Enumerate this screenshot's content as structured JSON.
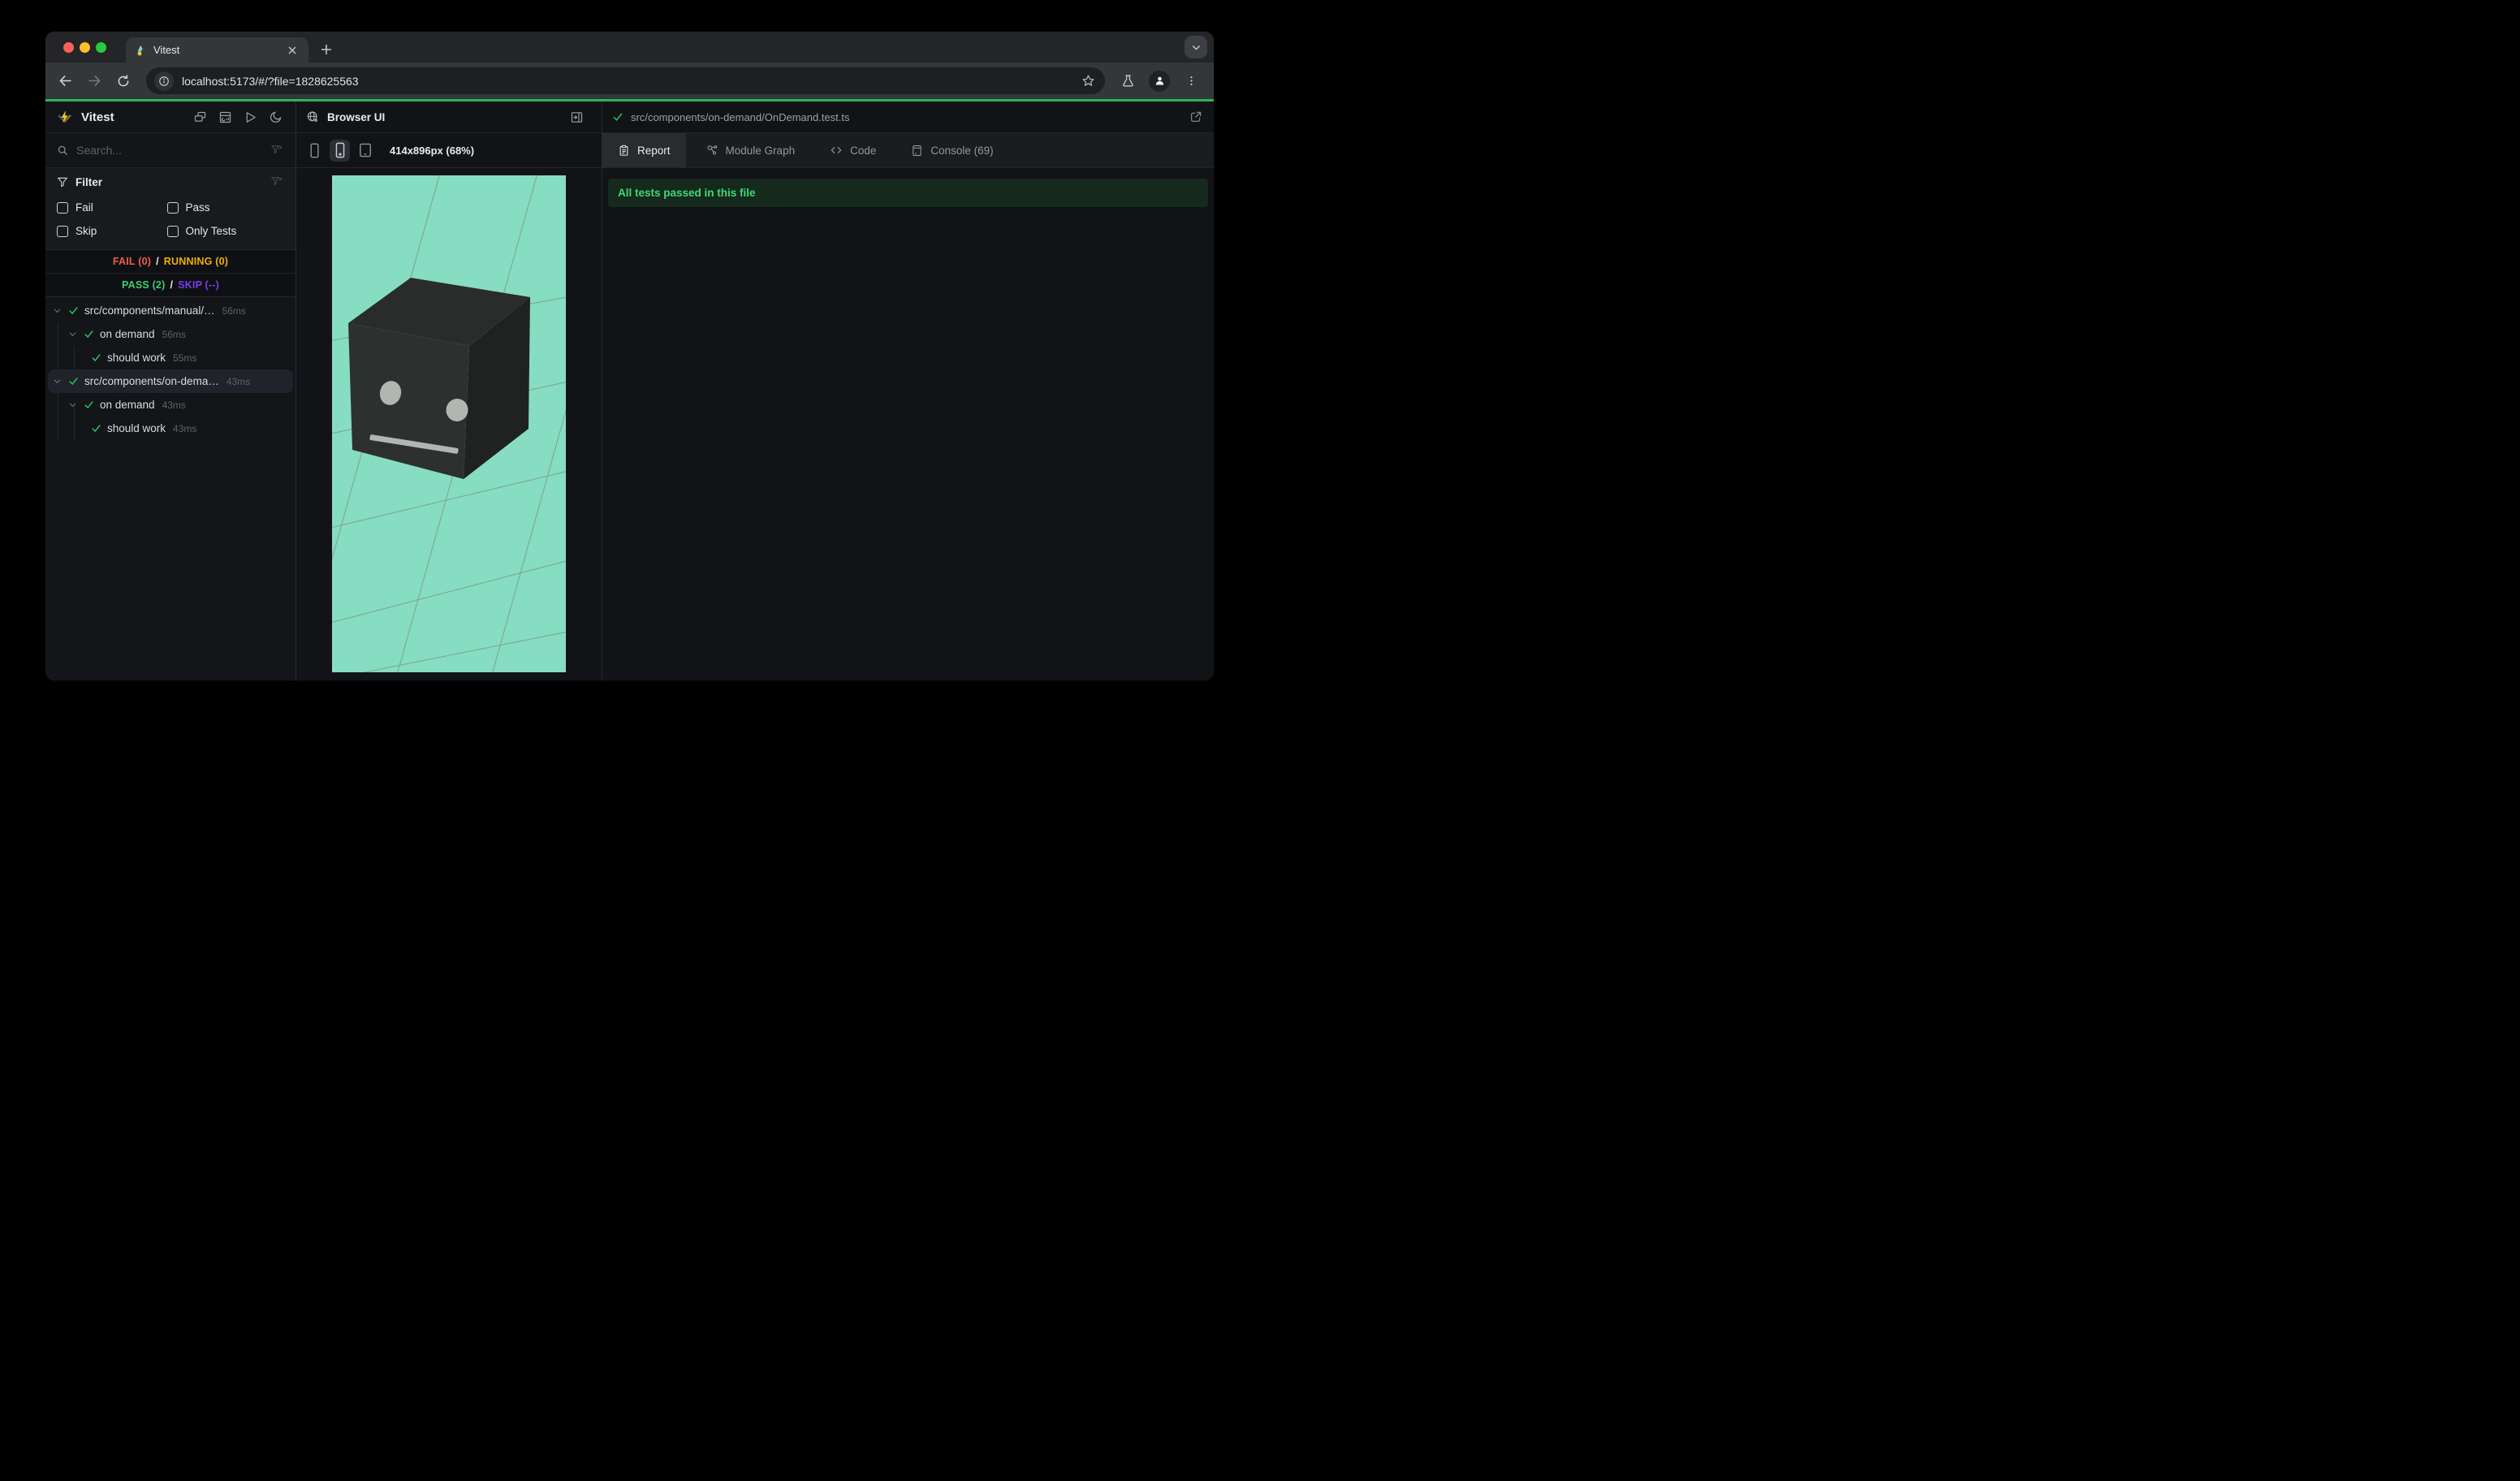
{
  "window": {
    "tab_title": "Vitest",
    "url": "localhost:5173/#/?file=1828625563"
  },
  "sidebar": {
    "app_title": "Vitest",
    "search_placeholder": "Search...",
    "filter": {
      "title": "Filter",
      "options": [
        "Fail",
        "Pass",
        "Skip",
        "Only Tests"
      ]
    },
    "status": {
      "line1": [
        {
          "text": "FAIL (0)",
          "color": "#f25c54"
        },
        {
          "text": "/",
          "color": "#e8eaed"
        },
        {
          "text": "RUNNING (0)",
          "color": "#efb100"
        }
      ],
      "line2": [
        {
          "text": "PASS (2)",
          "color": "#3ecb6e"
        },
        {
          "text": "/",
          "color": "#e8eaed"
        },
        {
          "text": "SKIP (--)",
          "color": "#7c3aed"
        }
      ]
    },
    "tree": [
      {
        "label": "src/components/manual/…",
        "time": "56ms",
        "level": 0,
        "chevron": true,
        "selected": false
      },
      {
        "label": "on demand",
        "time": "56ms",
        "level": 1,
        "chevron": true,
        "selected": false
      },
      {
        "label": "should work",
        "time": "55ms",
        "level": 2,
        "chevron": false,
        "selected": false
      },
      {
        "label": "src/components/on-dema…",
        "time": "43ms",
        "level": 0,
        "chevron": true,
        "selected": true
      },
      {
        "label": "on demand",
        "time": "43ms",
        "level": 1,
        "chevron": true,
        "selected": false
      },
      {
        "label": "should work",
        "time": "43ms",
        "level": 2,
        "chevron": false,
        "selected": false
      }
    ]
  },
  "preview": {
    "title": "Browser UI",
    "viewport_label": "414x896px (68%)"
  },
  "details": {
    "file_path": "src/components/on-demand/OnDemand.test.ts",
    "tabs": [
      "Report",
      "Module Graph",
      "Code",
      "Console (69)"
    ],
    "active_tab": "Report",
    "banner": "All tests passed in this file"
  },
  "colors": {
    "progress_green": "#2ab45a",
    "pass_green": "#3ecb6e",
    "fail_red": "#f25c54",
    "running_yellow": "#efb100",
    "skip_purple": "#7c3aed",
    "mint_background": "#86ddc1",
    "banner_bg": "#15291c",
    "banner_text": "#40d975"
  }
}
